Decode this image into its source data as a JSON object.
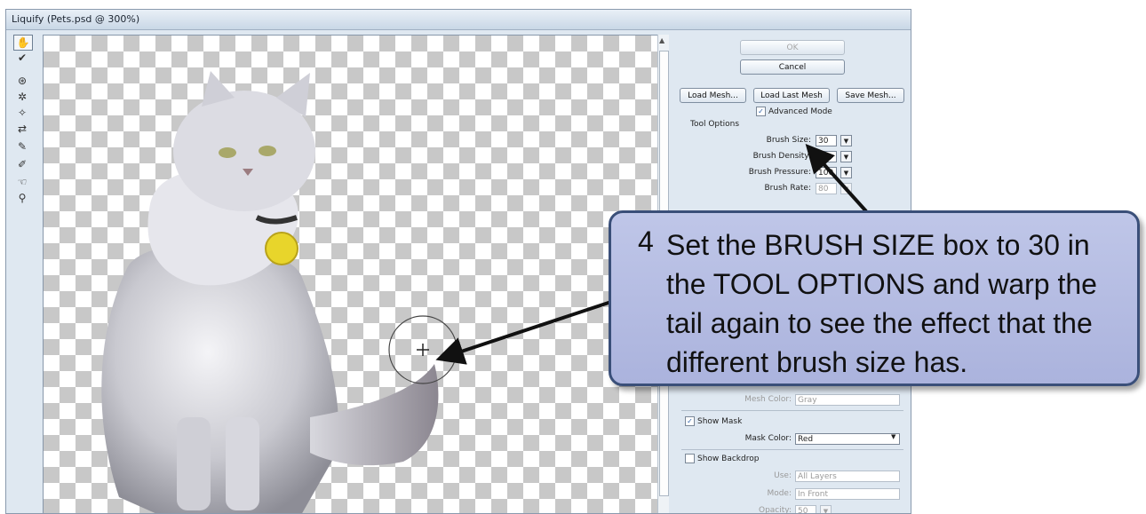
{
  "window": {
    "title": "Liquify (Pets.psd @ 300%)"
  },
  "tools": [
    {
      "icon": "forward-warp-tool-icon",
      "glyph": "✋"
    },
    {
      "icon": "reconstruct-tool-icon",
      "glyph": "✔"
    },
    {
      "icon": "twirl-tool-icon",
      "glyph": "⊛"
    },
    {
      "icon": "pucker-tool-icon",
      "glyph": "✲"
    },
    {
      "icon": "bloat-tool-icon",
      "glyph": "✧"
    },
    {
      "icon": "push-left-tool-icon",
      "glyph": "⇄"
    },
    {
      "icon": "freeze-mask-tool-icon",
      "glyph": "✎"
    },
    {
      "icon": "thaw-mask-tool-icon",
      "glyph": "✐"
    },
    {
      "icon": "hand-tool-icon",
      "glyph": "☜"
    },
    {
      "icon": "zoom-tool-icon",
      "glyph": "⚲"
    }
  ],
  "buttons": {
    "ok": "OK",
    "cancel": "Cancel",
    "load_mesh": "Load Mesh...",
    "load_last_mesh": "Load Last Mesh",
    "save_mesh": "Save Mesh..."
  },
  "advanced_mode": "Advanced Mode",
  "tool_options": {
    "heading": "Tool Options",
    "brush_size_label": "Brush Size:",
    "brush_size": "30",
    "brush_density_label": "Brush Density:",
    "brush_density": "50",
    "brush_pressure_label": "Brush Pressure:",
    "brush_pressure": "100",
    "brush_rate_label": "Brush Rate:",
    "brush_rate": "80"
  },
  "view_options": {
    "mesh_color_label": "Mesh Color:",
    "mesh_color": "Gray",
    "show_mask": "Show Mask",
    "mask_color_label": "Mask Color:",
    "mask_color": "Red",
    "show_backdrop": "Show Backdrop",
    "use_label": "Use:",
    "use": "All Layers",
    "mode_label": "Mode:",
    "mode": "In Front",
    "opacity_label": "Opacity:",
    "opacity": "50"
  },
  "callout": {
    "number": "4",
    "text": "Set the BRUSH SIZE box to 30 in the TOOL OPTIONS and warp the tail again to see the effect that the different brush size has."
  },
  "colors": {
    "callout_fill": "#b6bde3",
    "callout_border": "#3a4f79",
    "checker": "#c8c8c8"
  }
}
